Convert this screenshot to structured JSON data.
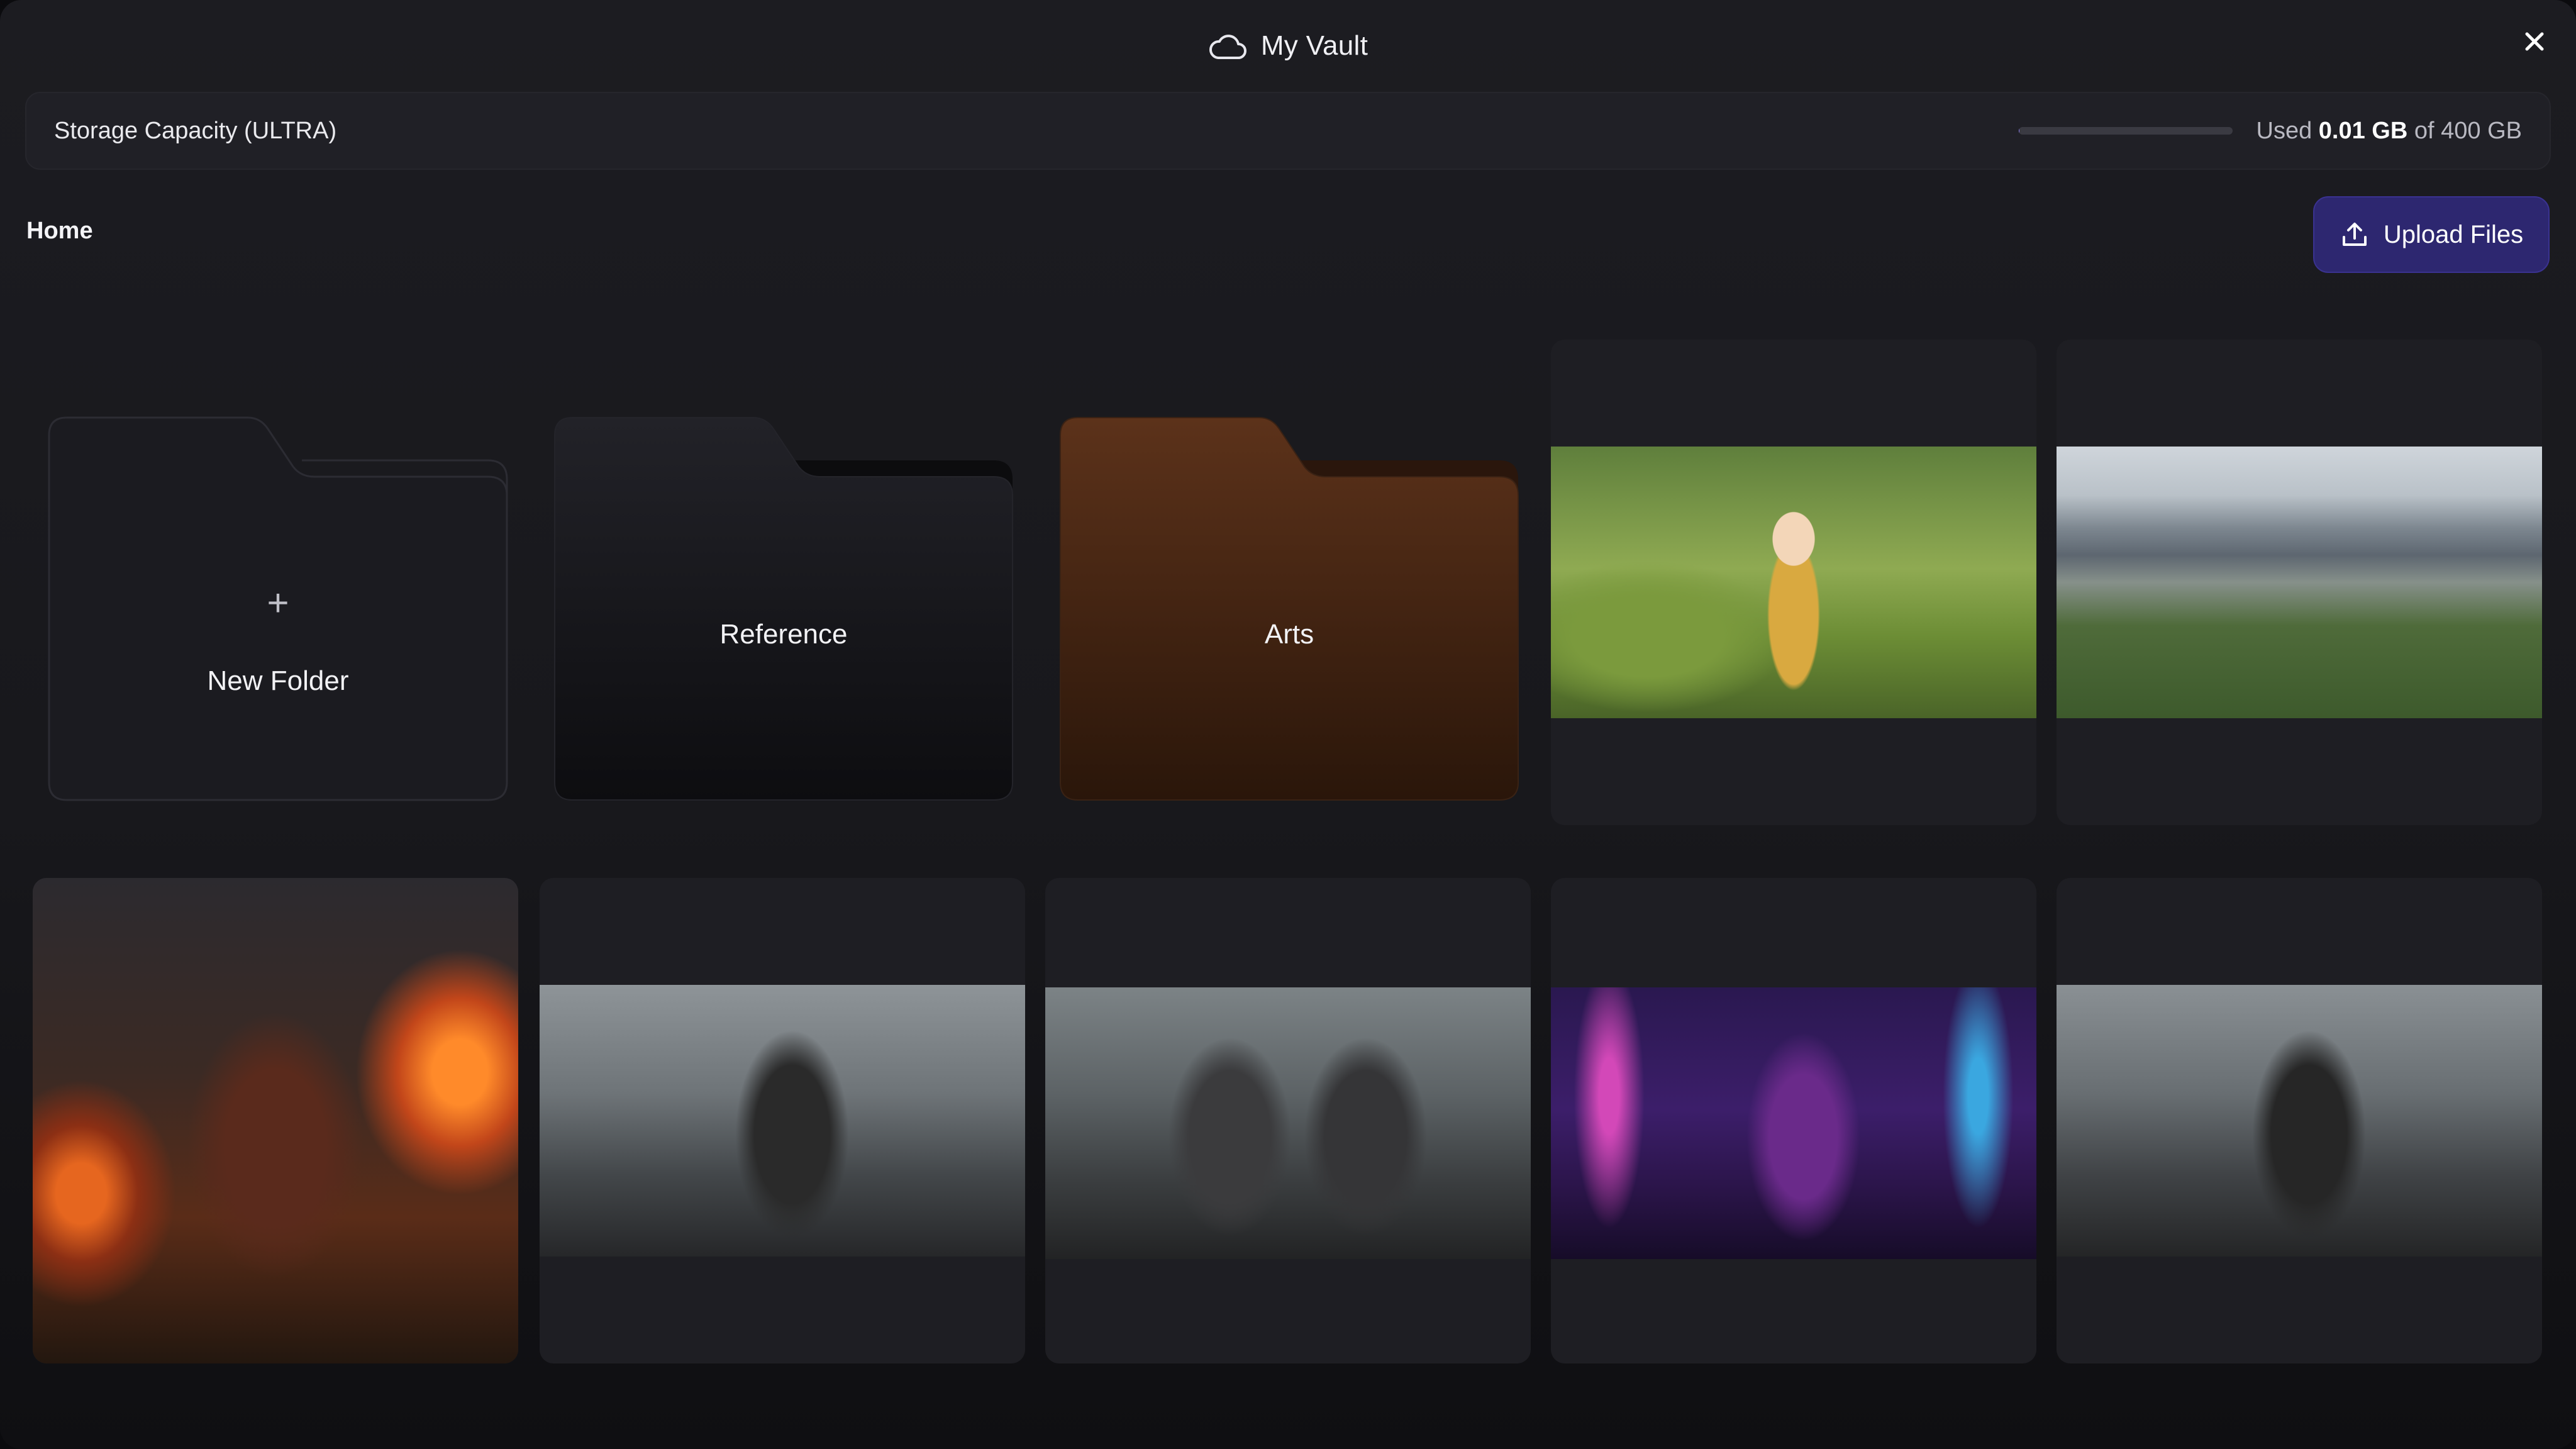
{
  "window": {
    "title": "My Vault",
    "title_icon": "cloud-icon",
    "close_icon": "close-icon"
  },
  "storage": {
    "label": "Storage Capacity (ULTRA)",
    "used_prefix": "Used",
    "used_value": "0.01 GB",
    "used_suffix": "of 400 GB",
    "used_fraction": 2.5e-05
  },
  "breadcrumb": {
    "current": "Home"
  },
  "upload": {
    "label": "Upload Files",
    "icon": "upload-icon"
  },
  "folders": [
    {
      "label": "New Folder",
      "icon": "plus-icon"
    },
    {
      "label": "Reference"
    },
    {
      "label": "Arts"
    }
  ],
  "images": [
    {
      "name": "girl-in-garden"
    },
    {
      "name": "mountain-village"
    },
    {
      "name": "samurai-fire"
    },
    {
      "name": "knight-battlefield"
    },
    {
      "name": "knights-fighting"
    },
    {
      "name": "neon-city-woman"
    },
    {
      "name": "knight-battlefield-2"
    }
  ],
  "colors": {
    "accent": "#2d2770",
    "arts_folder": "#5a3018"
  }
}
